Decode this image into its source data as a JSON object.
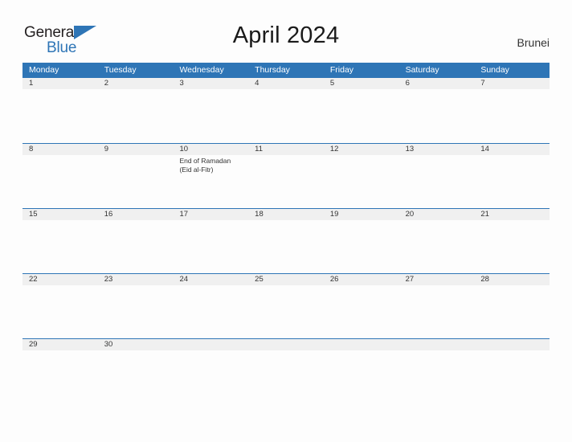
{
  "brand": {
    "name_part1": "General",
    "name_part2": "Blue",
    "flag_icon": "triangle-flag-icon",
    "accent_color": "#2e75b6"
  },
  "header": {
    "title": "April 2024",
    "country": "Brunei"
  },
  "colors": {
    "header_blue": "#2e75b6",
    "date_band_gray": "#f0f0f0",
    "text_dark": "#333333",
    "page_background": "#fdfdfd"
  },
  "calendar": {
    "weekdays": [
      "Monday",
      "Tuesday",
      "Wednesday",
      "Thursday",
      "Friday",
      "Saturday",
      "Sunday"
    ],
    "weeks": [
      {
        "dates": [
          "1",
          "2",
          "3",
          "4",
          "5",
          "6",
          "7"
        ],
        "events": [
          [],
          [],
          [],
          [],
          [],
          [],
          []
        ]
      },
      {
        "dates": [
          "8",
          "9",
          "10",
          "11",
          "12",
          "13",
          "14"
        ],
        "events": [
          [],
          [],
          [
            "End of Ramadan",
            "(Eid al-Fitr)"
          ],
          [],
          [],
          [],
          []
        ]
      },
      {
        "dates": [
          "15",
          "16",
          "17",
          "18",
          "19",
          "20",
          "21"
        ],
        "events": [
          [],
          [],
          [],
          [],
          [],
          [],
          []
        ]
      },
      {
        "dates": [
          "22",
          "23",
          "24",
          "25",
          "26",
          "27",
          "28"
        ],
        "events": [
          [],
          [],
          [],
          [],
          [],
          [],
          []
        ]
      },
      {
        "dates": [
          "29",
          "30",
          "",
          "",
          "",
          "",
          ""
        ],
        "events": [
          [],
          [],
          [],
          [],
          [],
          [],
          []
        ]
      }
    ]
  }
}
